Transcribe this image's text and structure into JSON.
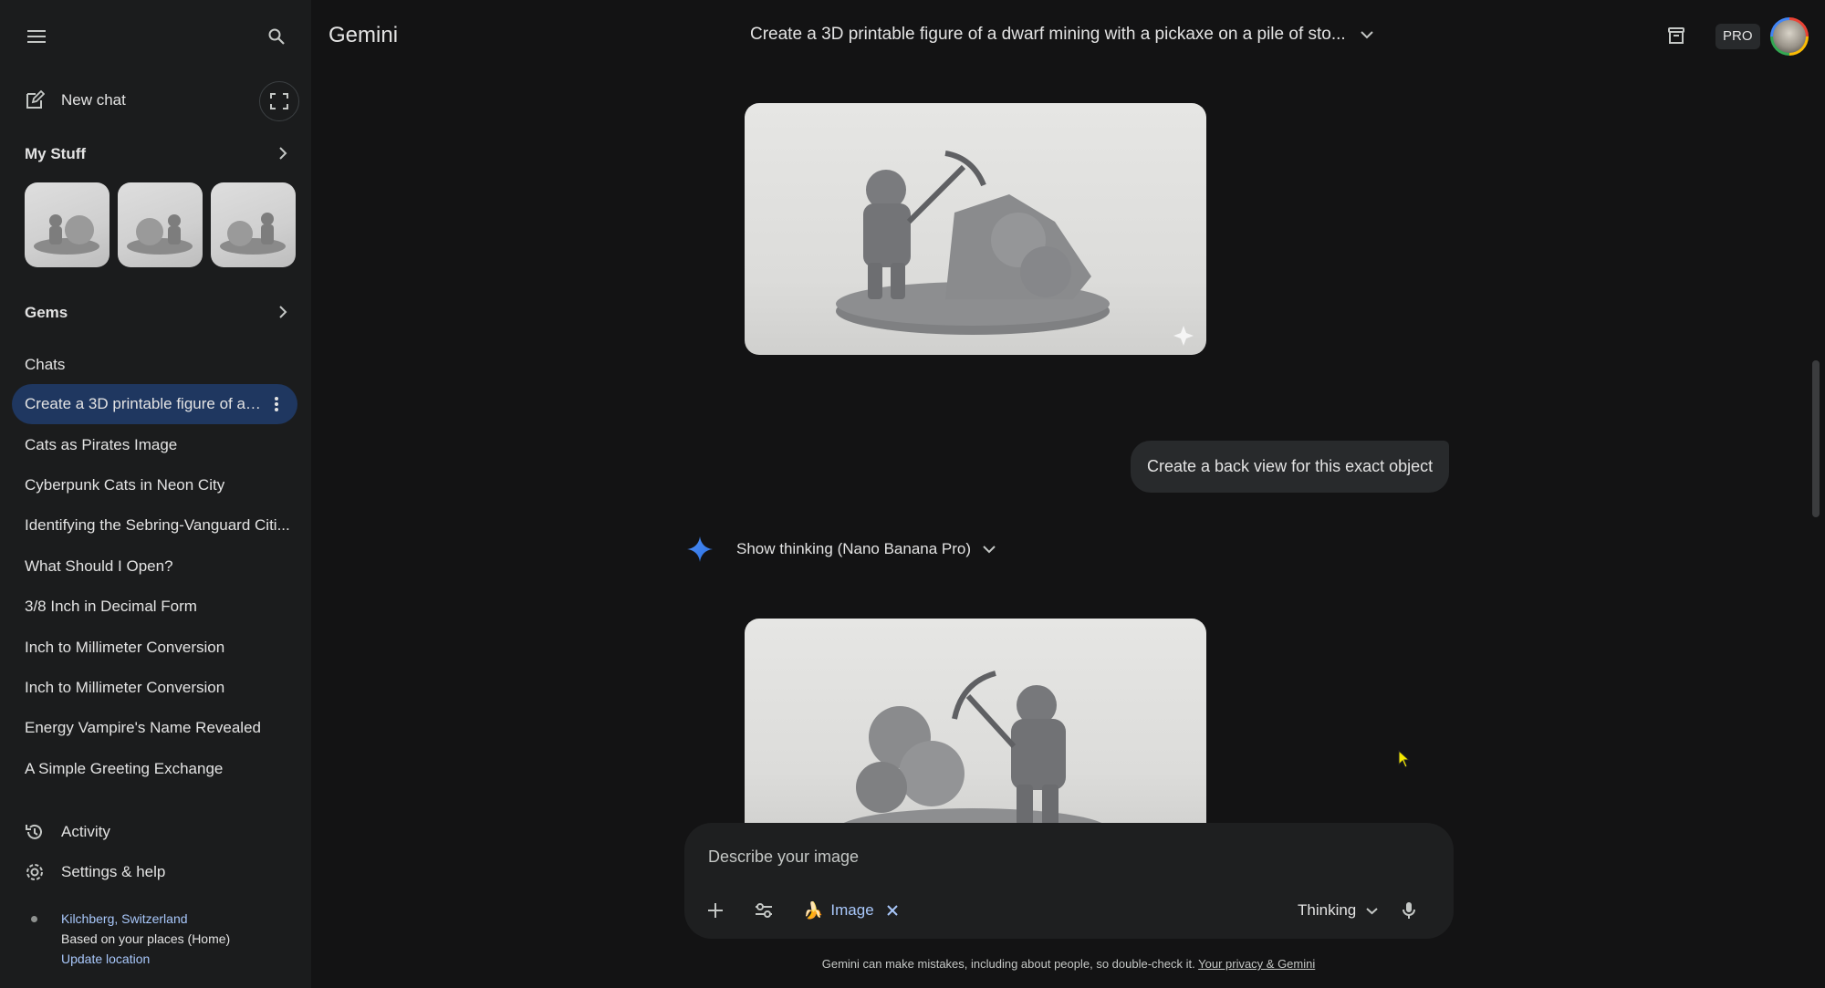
{
  "app": {
    "title": "Gemini",
    "conversation_title": "Create a 3D printable figure of a dwarf mining with a pickaxe on a pile of sto...",
    "badge": "PRO"
  },
  "sidebar": {
    "new_chat": "New chat",
    "my_stuff": "My Stuff",
    "gems": "Gems",
    "chats_title": "Chats",
    "chats": [
      "Create a 3D printable figure of a ...",
      "Cats as Pirates Image",
      "Cyberpunk Cats in Neon City",
      "Identifying the Sebring-Vanguard Citi...",
      "What Should I Open?",
      "3/8 Inch in Decimal Form",
      "Inch to Millimeter Conversion",
      "Inch to Millimeter Conversion",
      "Energy Vampire's Name Revealed",
      "A Simple Greeting Exchange"
    ],
    "activity": "Activity",
    "settings": "Settings & help",
    "location": {
      "place": "Kilchberg, Switzerland",
      "basis": "Based on your places (Home)",
      "update": "Update location"
    }
  },
  "conversation": {
    "user_message": "Create a back view for this exact object",
    "thinking_label": "Show thinking (Nano Banana Pro)"
  },
  "composer": {
    "placeholder": "Describe your image",
    "tool_chip": "Image",
    "tool_chip_icon": "🍌",
    "mode": "Thinking"
  },
  "footer": {
    "disclaimer": "Gemini can make mistakes, including about people, so double-check it. ",
    "privacy_link": "Your privacy & Gemini"
  },
  "colors": {
    "accent_link": "#a8c7fa",
    "selected_chat": "#1f3760",
    "composer_bg": "#1e1f20"
  }
}
